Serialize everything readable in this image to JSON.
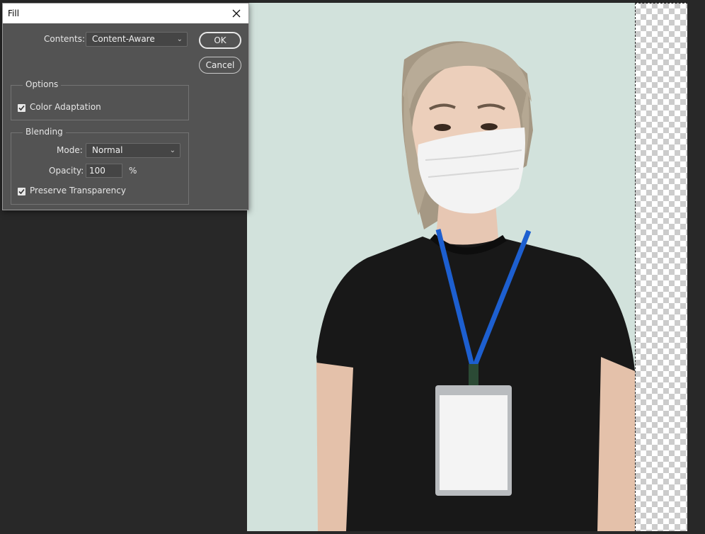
{
  "dialog": {
    "title": "Fill",
    "contents_label": "Contents:",
    "contents_value": "Content-Aware",
    "ok_label": "OK",
    "cancel_label": "Cancel",
    "options": {
      "title": "Options",
      "color_adaptation_label": "Color Adaptation",
      "color_adaptation_checked": true
    },
    "blending": {
      "title": "Blending",
      "mode_label": "Mode:",
      "mode_value": "Normal",
      "opacity_label": "Opacity:",
      "opacity_value": "100",
      "opacity_unit": "%",
      "preserve_transparency_label": "Preserve Transparency",
      "preserve_transparency_checked": true
    }
  },
  "canvas": {
    "background_color": "#d2e2dc",
    "transparent_region": true
  },
  "icons": {
    "close": "close-icon",
    "dropdown": "chevron-down-icon",
    "checkmark": "checkmark-icon"
  },
  "colors": {
    "app_bg": "#282828",
    "dialog_bg": "#535353",
    "lanyard": "#1d5fd0"
  }
}
